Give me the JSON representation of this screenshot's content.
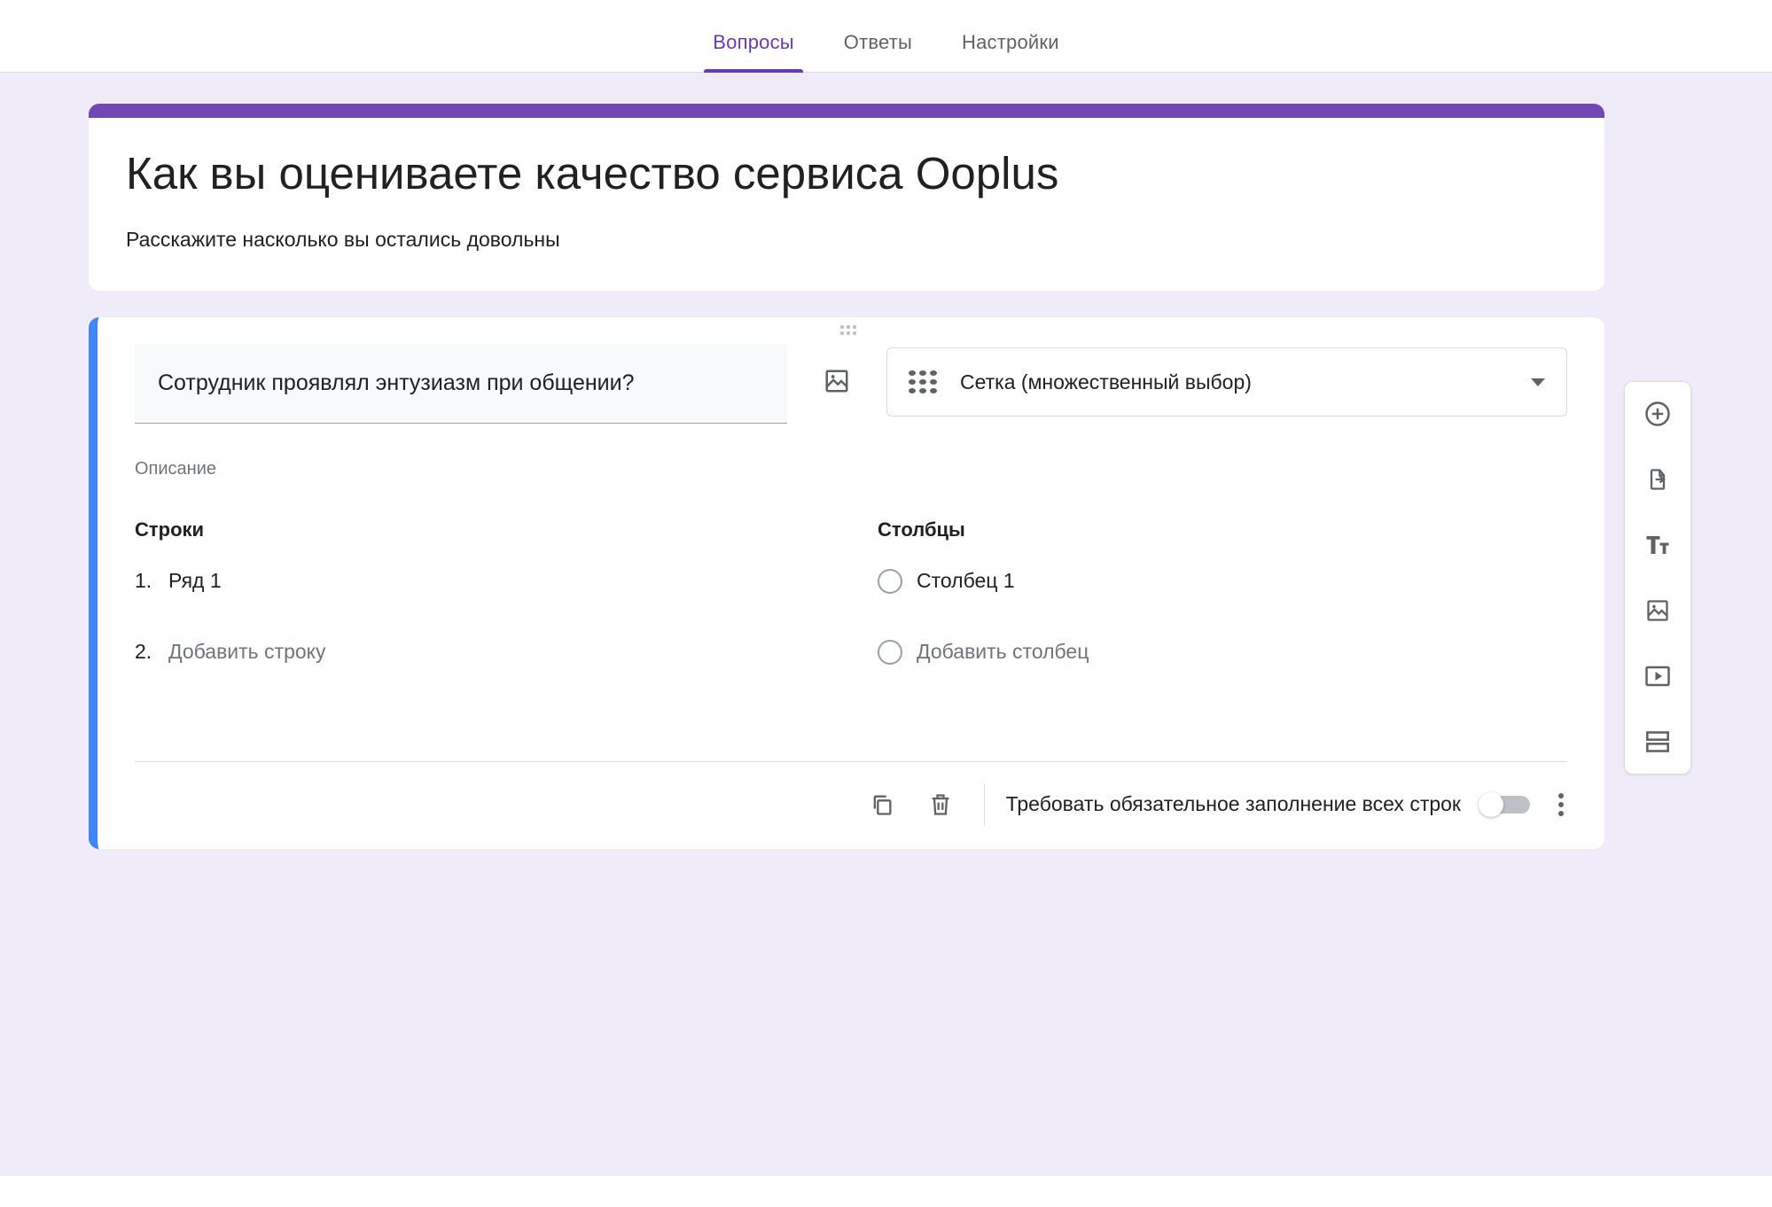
{
  "tabs": {
    "questions": "Вопросы",
    "answers": "Ответы",
    "settings": "Настройки",
    "active": "questions"
  },
  "form": {
    "title": "Как вы оцениваете качество сервиса Ooplus",
    "description": "Расскажите насколько вы остались довольны"
  },
  "question": {
    "title": "Сотрудник проявлял энтузиазм при общении?",
    "description_placeholder": "Описание",
    "type_label": "Сетка (множественный выбор)"
  },
  "grid": {
    "rows_header": "Строки",
    "cols_header": "Столбцы",
    "rows": [
      {
        "num": "1.",
        "label": "Ряд 1"
      }
    ],
    "add_row_num": "2.",
    "add_row_label": "Добавить строку",
    "cols": [
      {
        "label": "Столбец 1"
      }
    ],
    "add_col_label": "Добавить столбец"
  },
  "footer": {
    "required_label": "Требовать обязательное заполнение всех строк",
    "required_on": false
  },
  "colors": {
    "accent": "#673ab7"
  }
}
